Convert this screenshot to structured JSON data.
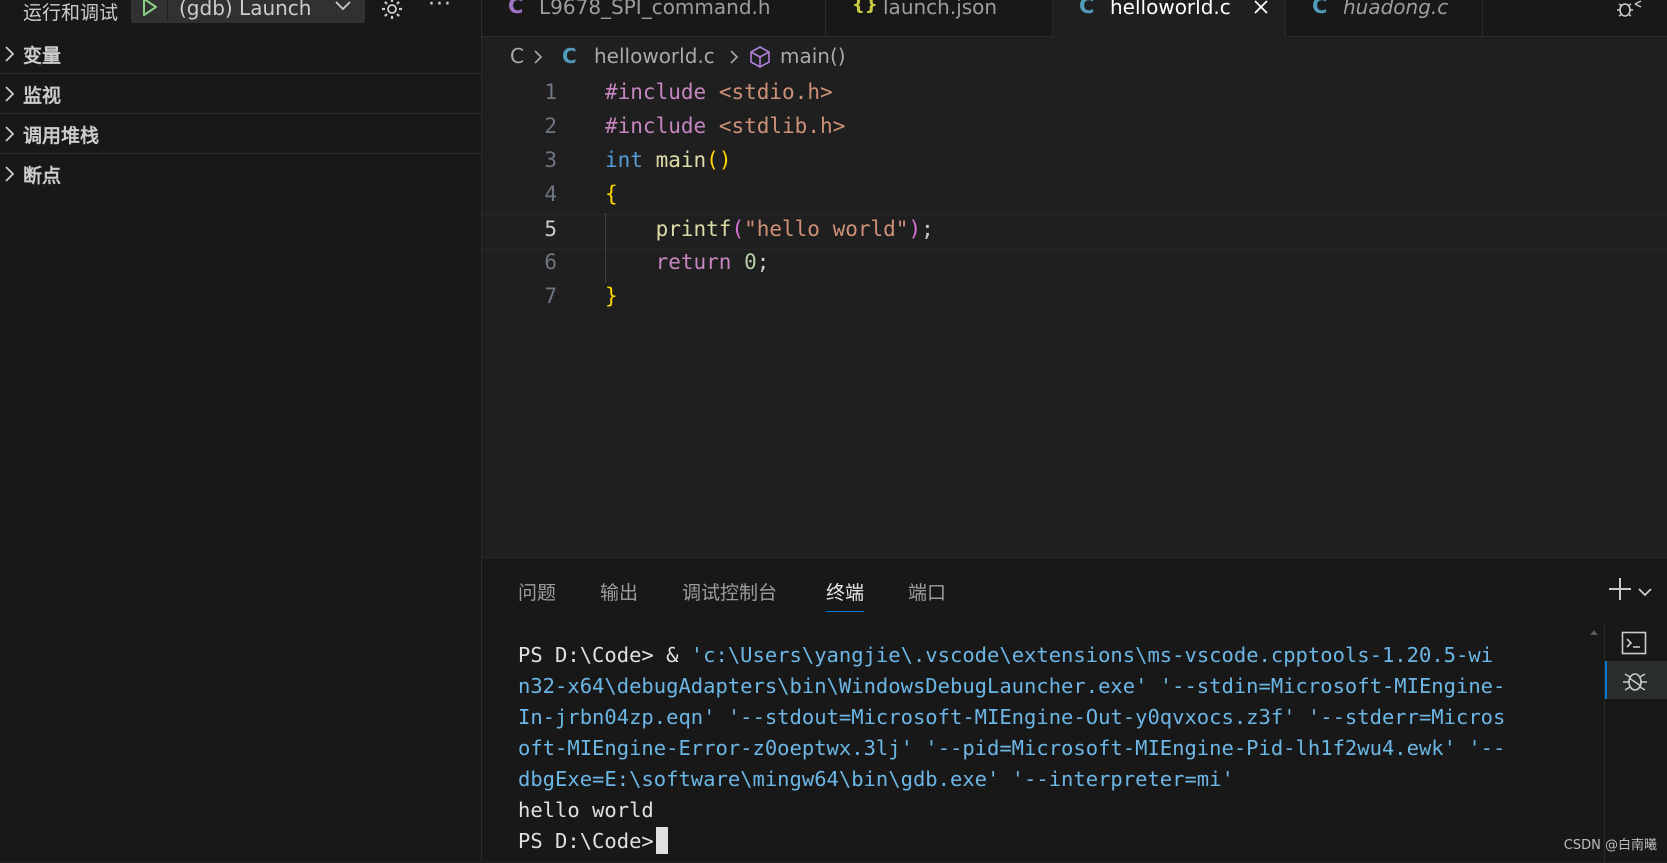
{
  "sidebar": {
    "title": "运行和调试",
    "launch_config": "(gdb) Launch",
    "sections": [
      {
        "label": "变量"
      },
      {
        "label": "监视"
      },
      {
        "label": "调用堆栈"
      },
      {
        "label": "断点"
      }
    ]
  },
  "tabs": [
    {
      "icon": "C",
      "icon_color": "#a074c4",
      "name": "L9678_SPI_command.h"
    },
    {
      "icon": "{}",
      "icon_color": "#cbcb41",
      "name": "launch.json"
    },
    {
      "icon": "C",
      "icon_color": "#519aba",
      "name": "helloworld.c",
      "active": true
    },
    {
      "icon": "C",
      "icon_color": "#519aba",
      "name": "huadong.c"
    }
  ],
  "breadcrumb": {
    "folder": "C",
    "file_icon": "C",
    "file": "helloworld.c",
    "symbol": "main()"
  },
  "code": {
    "line_numbers": [
      "1",
      "2",
      "3",
      "4",
      "5",
      "6",
      "7"
    ],
    "l1": {
      "dir": "#include",
      "hdr": "<stdio.h>"
    },
    "l2": {
      "dir": "#include",
      "hdr": "<stdlib.h>"
    },
    "l3": {
      "type": "int",
      "name": "main",
      "parens": "()"
    },
    "l4": {
      "brace": "{"
    },
    "l5": {
      "fn": "printf",
      "open": "(",
      "str": "\"hello world\"",
      "close": ")",
      "semi": ";"
    },
    "l6": {
      "kw": "return",
      "num": "0",
      "semi": ";"
    },
    "l7": {
      "brace": "}"
    }
  },
  "panel": {
    "tabs": [
      {
        "label": "问题"
      },
      {
        "label": "输出"
      },
      {
        "label": "调试控制台"
      },
      {
        "label": "终端",
        "active": true
      },
      {
        "label": "端口"
      }
    ]
  },
  "terminal": {
    "prompt": "PS D:\\Code>",
    "cmd_prefix": " & ",
    "lines": [
      "'c:\\Users\\yangjie\\.vscode\\extensions\\ms-vscode.cpptools-1.20.5-wi",
      "n32-x64\\debugAdapters\\bin\\WindowsDebugLauncher.exe' '--stdin=Microsoft-MIEngine-",
      "In-jrbn04zp.eqn' '--stdout=Microsoft-MIEngine-Out-y0qvxocs.z3f' '--stderr=Micros",
      "oft-MIEngine-Error-z0oeptwx.3lj' '--pid=Microsoft-MIEngine-Pid-lh1f2wu4.ewk' '--",
      "dbgExe=E:\\software\\mingw64\\bin\\gdb.exe' '--interpreter=mi'"
    ],
    "output": "hello world",
    "final_prompt": "PS D:\\Code>"
  },
  "watermark": "CSDN @白南曦"
}
